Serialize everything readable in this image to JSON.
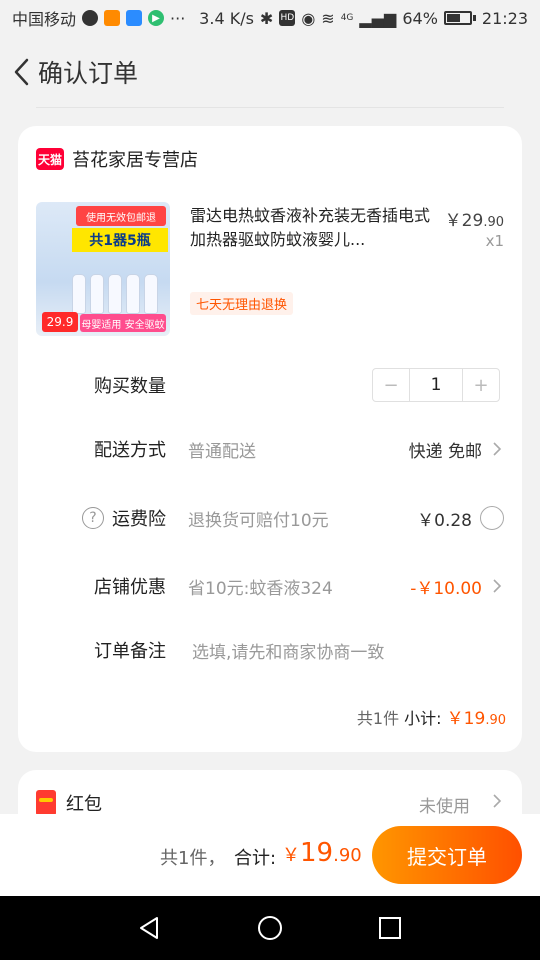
{
  "status_bar": {
    "carrier": "中国移动",
    "net_speed": "3.4 K/s",
    "network": "4G",
    "battery": "64%",
    "battery_level": 0.64,
    "time": "21:23"
  },
  "header": {
    "title": "确认订单"
  },
  "order": {
    "shop_name": "苔花家居专营店",
    "shop_badge": "天猫",
    "product": {
      "title": "雷达电热蚊香液补充装无香插电式加热器驱蚊防蚊液婴儿...",
      "price_main": "￥29",
      "price_decimal": ".90",
      "qty": "x1",
      "return_tag": "七天无理由退换",
      "thumb_badge": "使用无效包邮退",
      "thumb_big": "共1器5瓶",
      "thumb_price": "29.9",
      "thumb_strip": "母婴适用 安全驱蚊"
    },
    "quantity": {
      "label": "购买数量",
      "minus": "−",
      "value": "1",
      "plus": "+"
    },
    "delivery": {
      "label": "配送方式",
      "sub": "普通配送",
      "value": "快递 免邮"
    },
    "insurance": {
      "label": "运费险",
      "sub": "退换货可赔付10元",
      "value": "￥0.28"
    },
    "discount": {
      "label": "店铺优惠",
      "sub": "省10元:蚊香液324",
      "value": "-￥10.00"
    },
    "note": {
      "label": "订单备注",
      "placeholder": "选填,请先和商家协商一致"
    },
    "subtotal": {
      "count": "共1件",
      "label": "小计:",
      "currency": "￥",
      "main": "19",
      "decimal": ".90"
    }
  },
  "red_packet": {
    "label": "红包",
    "status": "未使用"
  },
  "footer": {
    "count": "共1件，",
    "total_label": "合计:",
    "currency": "￥",
    "total_main": "19",
    "total_decimal": ".90",
    "submit_label": "提交订单"
  },
  "colors": {
    "accent": "#ff5500",
    "tmall": "#ff0036",
    "submit_gradient_start": "#ff9600",
    "submit_gradient_end": "#ff5000"
  }
}
